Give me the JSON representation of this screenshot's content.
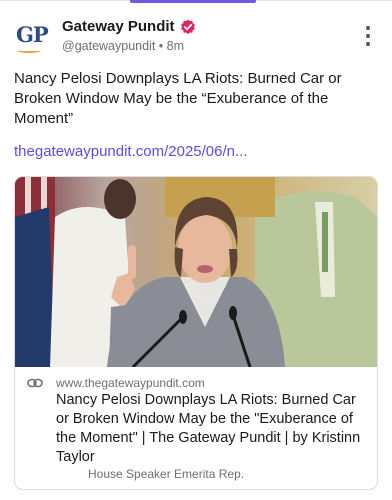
{
  "account": {
    "display_name": "Gateway Pundit",
    "handle": "@gatewaypundit",
    "separator": "•",
    "time_ago": "8m",
    "avatar_text": "GP",
    "verified_icon": "verified-badge-icon",
    "more_icon": "more-vertical-icon"
  },
  "post": {
    "text": "Nancy Pelosi Downplays LA Riots: Burned Car or Broken Window May be the “Exuberance of the Moment”",
    "link_text": "thegatewaypundit.com/2025/06/n..."
  },
  "link_card": {
    "icon": "link-icon",
    "domain": "www.thegatewaypundit.com",
    "title": "Nancy Pelosi Downplays LA Riots: Burned Car or Broken Window May be the \"Exuberance of the Moment\" | The Gateway Pundit | by Kristinn Taylor",
    "description": "House Speaker Emerita Rep."
  },
  "colors": {
    "accent": "#5b4fd6",
    "verified": "#e0245e",
    "avatar_blue": "#2d4a86",
    "avatar_orange": "#e8a33a"
  }
}
